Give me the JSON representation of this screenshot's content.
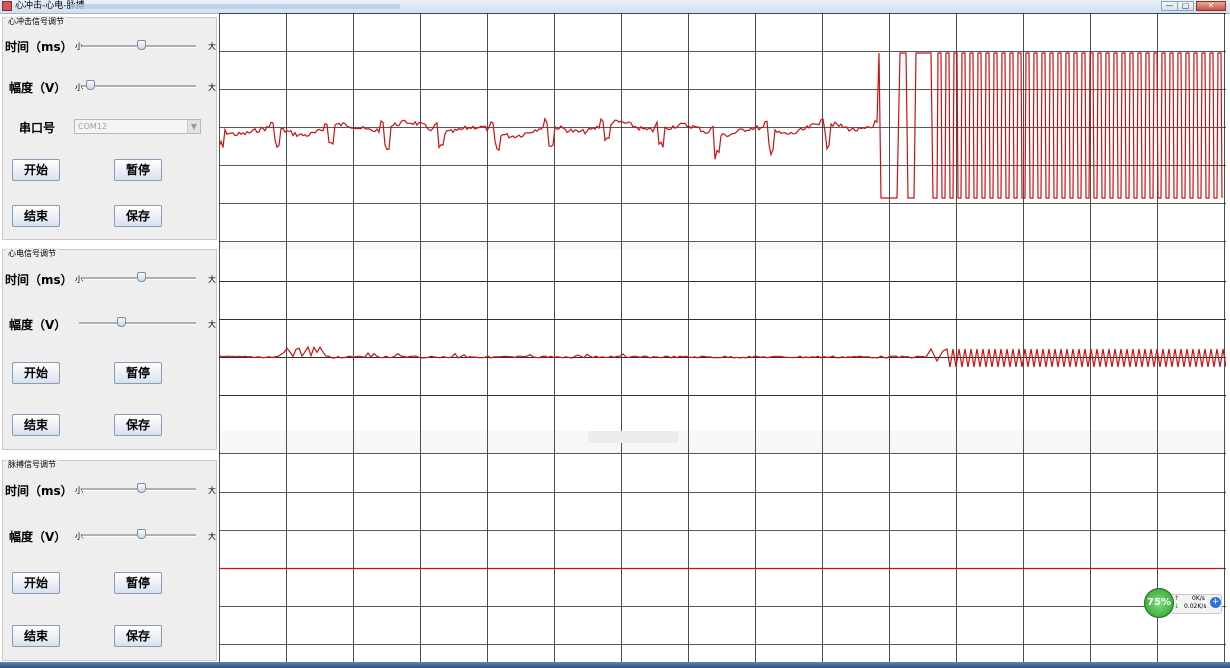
{
  "window": {
    "title": "心冲击-心电-脉搏",
    "buttons": {
      "minimize": "—",
      "maximize": "▢",
      "close": "✕"
    }
  },
  "panels": [
    {
      "title": "心冲击信号调节",
      "time_label": "时间（ms）",
      "amp_label": "幅度（V）",
      "min_label": "小",
      "max_label": "大",
      "time_slider": 0.52,
      "amp_slider": 0.07,
      "serial_label": "串口号",
      "serial_value": "COM12",
      "start": "开始",
      "pause": "暂停",
      "end": "结束",
      "save": "保存"
    },
    {
      "title": "心电信号调节",
      "time_label": "时间（ms）",
      "amp_label": "幅度（V）",
      "min_label": "小",
      "max_label": "大",
      "time_slider": 0.52,
      "amp_slider": 0.36,
      "start": "开始",
      "pause": "暂停",
      "end": "结束",
      "save": "保存"
    },
    {
      "title": "脉搏信号调节",
      "time_label": "时间（ms）",
      "amp_label": "幅度（V）",
      "min_label": "小",
      "max_label": "大",
      "time_slider": 0.52,
      "amp_slider": 0.52,
      "start": "开始",
      "pause": "暂停",
      "end": "结束",
      "save": "保存"
    }
  ],
  "colors": {
    "signal": "#cc1111",
    "grid": "#000000"
  },
  "net_widget": {
    "percent": "75%",
    "up": "0K/s",
    "down": "0.02K/s"
  }
}
